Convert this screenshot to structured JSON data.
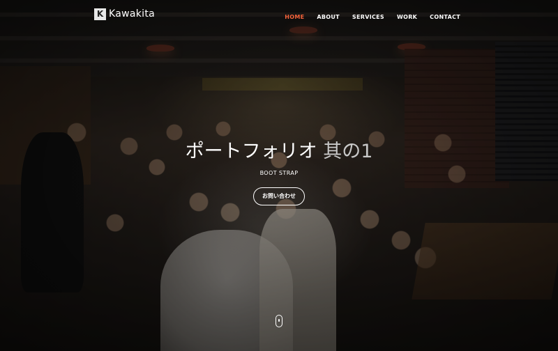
{
  "navbar": {
    "brand": {
      "logo_letter": "K",
      "name": "Kawakita"
    },
    "items": [
      {
        "label": "HOME",
        "active": true
      },
      {
        "label": "ABOUT",
        "active": false
      },
      {
        "label": "SERVICES",
        "active": false
      },
      {
        "label": "WORK",
        "active": false
      },
      {
        "label": "CONTACT",
        "active": false
      }
    ]
  },
  "hero": {
    "title_main": "ポートフォリオ ",
    "title_accent": "其の1",
    "subtitle": "BOOT STRAP",
    "cta_label": "お問い合わせ"
  },
  "colors": {
    "accent": "#f4623a",
    "text": "#ffffff"
  },
  "icons": {
    "scroll": "mouse-scroll-icon"
  }
}
